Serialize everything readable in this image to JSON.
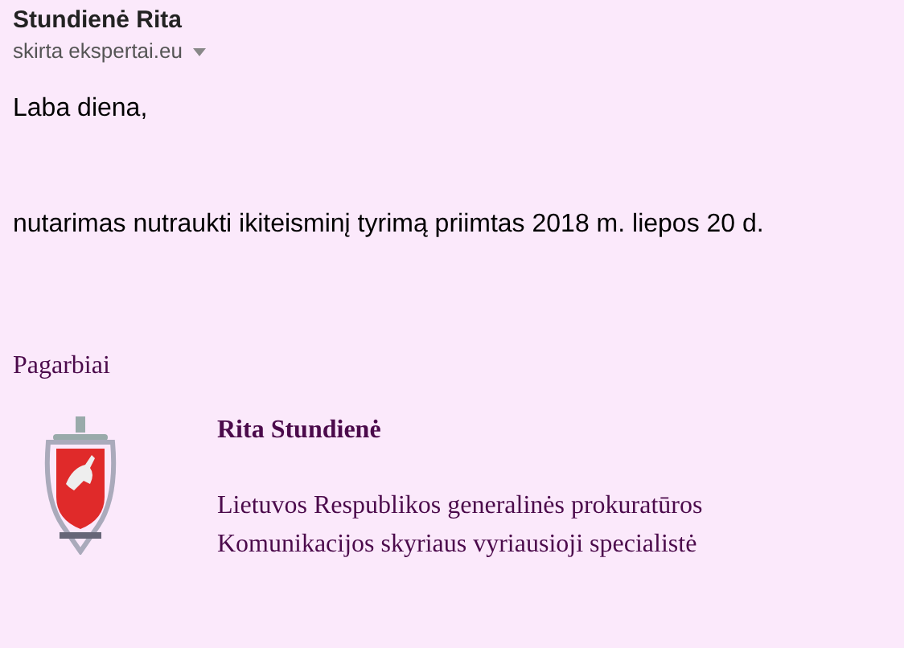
{
  "sender": {
    "name": "Stundienė Rita",
    "recipient": "skirta ekspertai.eu"
  },
  "body": {
    "greeting": "Laba diena,",
    "message": "nutarimas nutraukti ikiteisminį tyrimą priimtas 2018 m. liepos 20 d."
  },
  "signature": {
    "closing": "Pagarbiai",
    "name": "Rita Stundienė",
    "lines": [
      "Lietuvos Respublikos generalinės prokuratūros",
      "Komunikacijos skyriaus vyriausioji specialistė"
    ]
  }
}
